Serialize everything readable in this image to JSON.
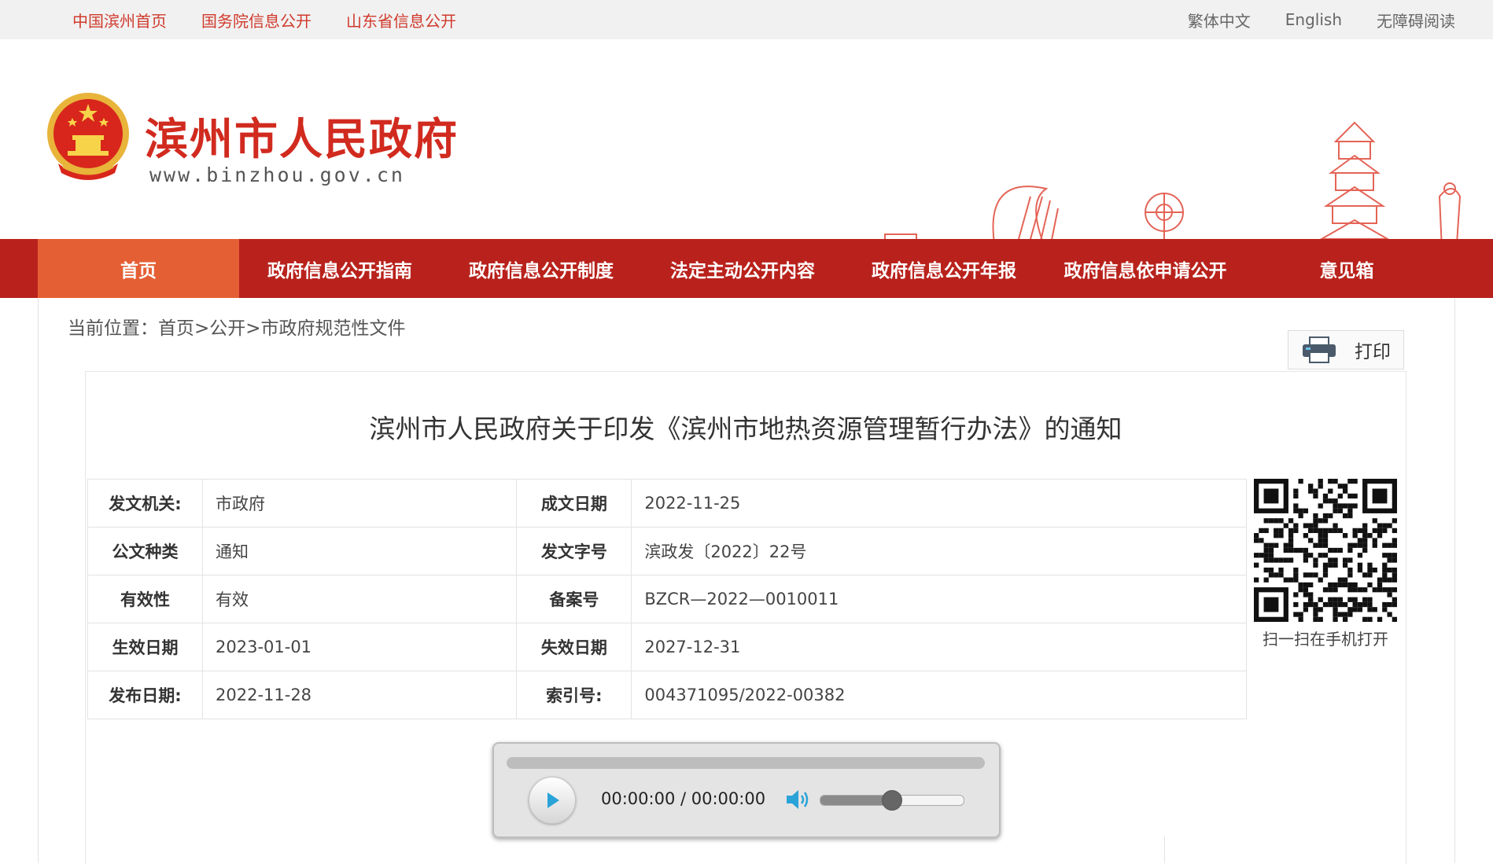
{
  "topbar": {
    "links": [
      "中国滨州首页",
      "国务院信息公开",
      "山东省信息公开"
    ],
    "right_links": [
      "繁体中文",
      "English",
      "无障碍阅读"
    ]
  },
  "header": {
    "site_title": "滨州市人民政府",
    "site_url": "www.binzhou.gov.cn"
  },
  "nav": {
    "items": [
      "首页",
      "政府信息公开指南",
      "政府信息公开制度",
      "法定主动公开内容",
      "政府信息公开年报",
      "政府信息依申请公开",
      "意见箱"
    ],
    "active_index": 0
  },
  "breadcrumb": {
    "text": "当前位置：首页>公开>市政府规范性文件"
  },
  "toolbar": {
    "print_label": "打印"
  },
  "document": {
    "title": "滨州市人民政府关于印发《滨州市地热资源管理暂行办法》的通知",
    "meta": [
      {
        "label": "发文机关:",
        "value": "市政府",
        "label2": "成文日期",
        "value2": "2022-11-25"
      },
      {
        "label": "公文种类",
        "value": "通知",
        "label2": "发文字号",
        "value2": "滨政发〔2022〕22号"
      },
      {
        "label": "有效性",
        "value": "有效",
        "label2": "备案号",
        "value2": "BZCR—2022—0010011"
      },
      {
        "label": "生效日期",
        "value": "2023-01-01",
        "label2": "失效日期",
        "value2": "2027-12-31"
      },
      {
        "label": "发布日期:",
        "value": "2022-11-28",
        "label2": "索引号:",
        "value2": "004371095/2022-00382"
      }
    ],
    "qr_caption": "扫一扫在手机打开"
  },
  "audio_player": {
    "time_display": "00:00:00 / 00:00:00",
    "volume_level": 0.5,
    "play_icon": "play-icon",
    "volume_icon": "speaker-icon"
  },
  "colors": {
    "brand_red": "#b9221c",
    "nav_active": "#e55f34",
    "link_red": "#d03a2d"
  }
}
